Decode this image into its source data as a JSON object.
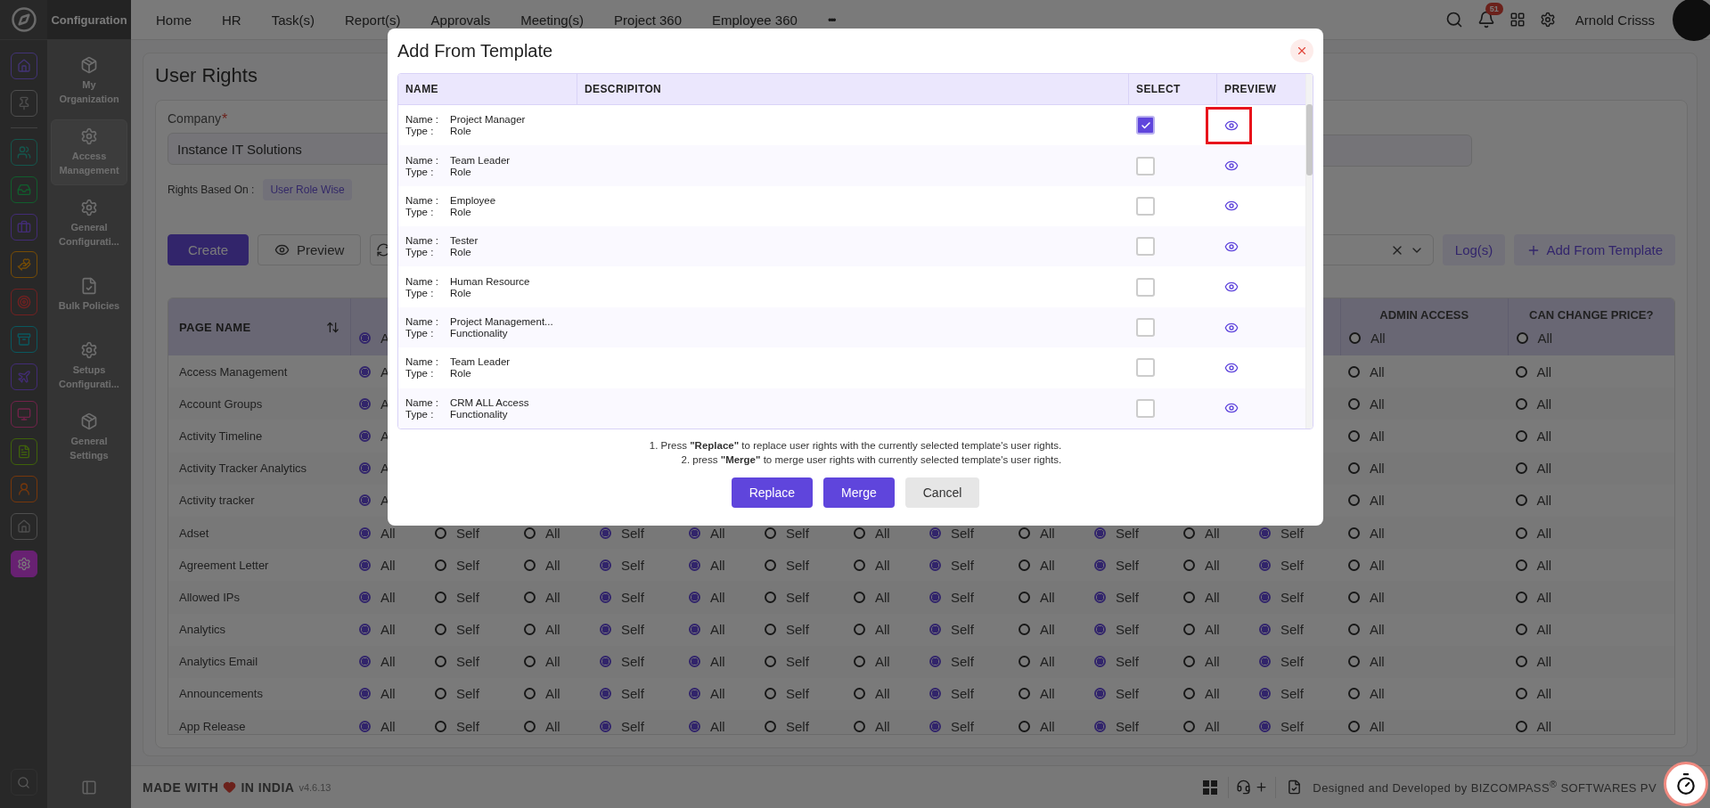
{
  "rail": {
    "items": [
      {
        "kind": "home",
        "selected": false
      },
      {
        "kind": "pin",
        "selected": false
      },
      {
        "kind": "people",
        "selected": false
      },
      {
        "kind": "inbox",
        "selected": false
      },
      {
        "kind": "briefcase",
        "selected": false
      },
      {
        "kind": "hands",
        "selected": false
      },
      {
        "kind": "target",
        "selected": false
      },
      {
        "kind": "archive",
        "selected": false
      },
      {
        "kind": "plane",
        "selected": false
      },
      {
        "kind": "monitor",
        "selected": false
      },
      {
        "kind": "file",
        "selected": false
      },
      {
        "kind": "person",
        "selected": false
      },
      {
        "kind": "house",
        "selected": false
      },
      {
        "kind": "gear",
        "selected": true
      }
    ]
  },
  "sidebar": {
    "title": "Configuration",
    "items": [
      {
        "kind": "cube",
        "label": "My Organization",
        "selected": false
      },
      {
        "kind": "gear",
        "label": "Access Management",
        "selected": true
      },
      {
        "kind": "gear",
        "label": "General Configurati...",
        "selected": false
      },
      {
        "kind": "file",
        "label": "Bulk Policies",
        "selected": false
      },
      {
        "kind": "gear",
        "label": "Setups Configurati...",
        "selected": false
      },
      {
        "kind": "cube",
        "label": "General Settings",
        "selected": false
      }
    ]
  },
  "topbar": {
    "nav": [
      "Home",
      "HR",
      "Task(s)",
      "Report(s)",
      "Approvals",
      "Meeting(s)",
      "Project 360",
      "Employee 360"
    ],
    "more": "•••",
    "notifications": "51",
    "user": "Arnold Crisss"
  },
  "page": {
    "title": "User Rights",
    "company": {
      "label": "Company",
      "required_mark": "*",
      "value": "Instance IT Solutions"
    },
    "rights_based_on": {
      "label": "Rights Based On :",
      "value": "User Role Wise"
    },
    "actions": [
      {
        "kind": "primary",
        "label": "Create"
      },
      {
        "kind": "preview",
        "label": "Preview"
      },
      {
        "kind": "icon"
      }
    ],
    "tools": {
      "logs": "Log(s)",
      "add_template": "Add From Template"
    }
  },
  "table": {
    "header": {
      "page_name": "PAGE NAME",
      "rights": [
        {
          "options": [
            {
              "label": "A",
              "selected": true
            }
          ]
        }
      ],
      "admin": {
        "label": "ADMIN ACCESS",
        "option": {
          "label": "All",
          "selected": false
        }
      },
      "price": {
        "label": "CAN CHANGE PRICE?",
        "option": {
          "label": "All",
          "selected": false
        }
      }
    },
    "rows": [
      {
        "page": "Access Management",
        "rights": [
          {
            "options": [
              {
                "label": "A",
                "selected": true
              }
            ]
          }
        ],
        "admin": {
          "label": "All",
          "selected": false
        },
        "price": {
          "label": "All",
          "selected": false
        }
      },
      {
        "page": "Account Groups",
        "rights": [
          {
            "options": [
              {
                "label": "A",
                "selected": true
              }
            ]
          }
        ],
        "admin": {
          "label": "All",
          "selected": false
        },
        "price": {
          "label": "All",
          "selected": false
        }
      },
      {
        "page": "Activity Timeline",
        "rights": [
          {
            "options": [
              {
                "label": "A",
                "selected": true
              }
            ]
          }
        ],
        "admin": {
          "label": "All",
          "selected": false
        },
        "price": {
          "label": "All",
          "selected": false
        }
      },
      {
        "page": "Activity Tracker Analytics",
        "rights": [
          {
            "options": [
              {
                "label": "A",
                "selected": true
              }
            ]
          }
        ],
        "admin": {
          "label": "All",
          "selected": false
        },
        "price": {
          "label": "All",
          "selected": false
        }
      },
      {
        "page": "Activity tracker",
        "rights": [
          {
            "options": [
              {
                "label": "A",
                "selected": true
              }
            ]
          }
        ],
        "admin": {
          "label": "All",
          "selected": false
        },
        "price": {
          "label": "All",
          "selected": false
        }
      },
      {
        "page": "Adset",
        "rights": [
          {
            "options": [
              {
                "label": "All",
                "selected": true
              },
              {
                "label": "Self",
                "selected": false
              }
            ]
          },
          {
            "options": [
              {
                "label": "All",
                "selected": false
              },
              {
                "label": "Self",
                "selected": true
              }
            ]
          },
          {
            "options": [
              {
                "label": "All",
                "selected": true
              },
              {
                "label": "Self",
                "selected": false
              }
            ]
          },
          {
            "options": [
              {
                "label": "All",
                "selected": false
              },
              {
                "label": "Self",
                "selected": true
              }
            ]
          },
          {
            "options": [
              {
                "label": "All",
                "selected": false
              },
              {
                "label": "Self",
                "selected": true
              }
            ]
          },
          {
            "options": [
              {
                "label": "All",
                "selected": false
              },
              {
                "label": "Self",
                "selected": true
              }
            ]
          }
        ],
        "admin": {
          "label": "All",
          "selected": false
        },
        "price": {
          "label": "All",
          "selected": false
        }
      },
      {
        "page": "Agreement Letter",
        "rights": [
          {
            "options": [
              {
                "label": "All",
                "selected": true
              },
              {
                "label": "Self",
                "selected": false
              }
            ]
          },
          {
            "options": [
              {
                "label": "All",
                "selected": false
              },
              {
                "label": "Self",
                "selected": true
              }
            ]
          },
          {
            "options": [
              {
                "label": "All",
                "selected": true
              },
              {
                "label": "Self",
                "selected": false
              }
            ]
          },
          {
            "options": [
              {
                "label": "All",
                "selected": false
              },
              {
                "label": "Self",
                "selected": true
              }
            ]
          },
          {
            "options": [
              {
                "label": "All",
                "selected": false
              },
              {
                "label": "Self",
                "selected": true
              }
            ]
          },
          {
            "options": [
              {
                "label": "All",
                "selected": false
              },
              {
                "label": "Self",
                "selected": true
              }
            ]
          }
        ],
        "admin": {
          "label": "All",
          "selected": false
        },
        "price": {
          "label": "All",
          "selected": false
        }
      },
      {
        "page": "Allowed IPs",
        "rights": [
          {
            "options": [
              {
                "label": "All",
                "selected": true
              },
              {
                "label": "Self",
                "selected": false
              }
            ]
          },
          {
            "options": [
              {
                "label": "All",
                "selected": false
              },
              {
                "label": "Self",
                "selected": true
              }
            ]
          },
          {
            "options": [
              {
                "label": "All",
                "selected": true
              },
              {
                "label": "Self",
                "selected": false
              }
            ]
          },
          {
            "options": [
              {
                "label": "All",
                "selected": false
              },
              {
                "label": "Self",
                "selected": true
              }
            ]
          },
          {
            "options": [
              {
                "label": "All",
                "selected": false
              },
              {
                "label": "Self",
                "selected": true
              }
            ]
          },
          {
            "options": [
              {
                "label": "All",
                "selected": false
              },
              {
                "label": "Self",
                "selected": true
              }
            ]
          }
        ],
        "admin": {
          "label": "All",
          "selected": false
        },
        "price": {
          "label": "All",
          "selected": false
        }
      },
      {
        "page": "Analytics",
        "rights": [
          {
            "options": [
              {
                "label": "All",
                "selected": true
              },
              {
                "label": "Self",
                "selected": false
              }
            ]
          },
          {
            "options": [
              {
                "label": "All",
                "selected": false
              },
              {
                "label": "Self",
                "selected": true
              }
            ]
          },
          {
            "options": [
              {
                "label": "All",
                "selected": true
              },
              {
                "label": "Self",
                "selected": false
              }
            ]
          },
          {
            "options": [
              {
                "label": "All",
                "selected": false
              },
              {
                "label": "Self",
                "selected": true
              }
            ]
          },
          {
            "options": [
              {
                "label": "All",
                "selected": false
              },
              {
                "label": "Self",
                "selected": true
              }
            ]
          },
          {
            "options": [
              {
                "label": "All",
                "selected": false
              },
              {
                "label": "Self",
                "selected": true
              }
            ]
          }
        ],
        "admin": {
          "label": "All",
          "selected": false
        },
        "price": {
          "label": "All",
          "selected": false
        }
      },
      {
        "page": "Analytics Email",
        "rights": [
          {
            "options": [
              {
                "label": "All",
                "selected": true
              },
              {
                "label": "Self",
                "selected": false
              }
            ]
          },
          {
            "options": [
              {
                "label": "All",
                "selected": false
              },
              {
                "label": "Self",
                "selected": true
              }
            ]
          },
          {
            "options": [
              {
                "label": "All",
                "selected": true
              },
              {
                "label": "Self",
                "selected": false
              }
            ]
          },
          {
            "options": [
              {
                "label": "All",
                "selected": false
              },
              {
                "label": "Self",
                "selected": true
              }
            ]
          },
          {
            "options": [
              {
                "label": "All",
                "selected": false
              },
              {
                "label": "Self",
                "selected": true
              }
            ]
          },
          {
            "options": [
              {
                "label": "All",
                "selected": false
              },
              {
                "label": "Self",
                "selected": true
              }
            ]
          }
        ],
        "admin": {
          "label": "All",
          "selected": false
        },
        "price": {
          "label": "All",
          "selected": false
        }
      },
      {
        "page": "Announcements",
        "rights": [
          {
            "options": [
              {
                "label": "All",
                "selected": true
              },
              {
                "label": "Self",
                "selected": false
              }
            ]
          },
          {
            "options": [
              {
                "label": "All",
                "selected": false
              },
              {
                "label": "Self",
                "selected": true
              }
            ]
          },
          {
            "options": [
              {
                "label": "All",
                "selected": true
              },
              {
                "label": "Self",
                "selected": false
              }
            ]
          },
          {
            "options": [
              {
                "label": "All",
                "selected": false
              },
              {
                "label": "Self",
                "selected": true
              }
            ]
          },
          {
            "options": [
              {
                "label": "All",
                "selected": false
              },
              {
                "label": "Self",
                "selected": true
              }
            ]
          },
          {
            "options": [
              {
                "label": "All",
                "selected": false
              },
              {
                "label": "Self",
                "selected": true
              }
            ]
          }
        ],
        "admin": {
          "label": "All",
          "selected": false
        },
        "price": {
          "label": "All",
          "selected": false
        }
      },
      {
        "page": "App Release",
        "rights": [
          {
            "options": [
              {
                "label": "All",
                "selected": true
              },
              {
                "label": "Self",
                "selected": false
              }
            ]
          },
          {
            "options": [
              {
                "label": "All",
                "selected": false
              },
              {
                "label": "Self",
                "selected": true
              }
            ]
          },
          {
            "options": [
              {
                "label": "All",
                "selected": true
              },
              {
                "label": "Self",
                "selected": false
              }
            ]
          },
          {
            "options": [
              {
                "label": "All",
                "selected": false
              },
              {
                "label": "Self",
                "selected": true
              }
            ]
          },
          {
            "options": [
              {
                "label": "All",
                "selected": false
              },
              {
                "label": "Self",
                "selected": true
              }
            ]
          },
          {
            "options": [
              {
                "label": "All",
                "selected": false
              },
              {
                "label": "Self",
                "selected": true
              }
            ]
          }
        ],
        "admin": {
          "label": "All",
          "selected": false
        },
        "price": {
          "label": "All",
          "selected": false
        }
      }
    ]
  },
  "footer": {
    "made_with": "MADE WITH",
    "in_india": "IN INDIA",
    "version": "v4.6.13",
    "credit": "Designed and Developed by  BIZCOMPASS$^{®}$ SOFTWARES PV"
  },
  "modal": {
    "title": "Add From Template",
    "columns": [
      "NAME",
      "DESCRIPITON",
      "SELECT",
      "PREVIEW"
    ],
    "rows": [
      {
        "name_label": "Name :",
        "name": "Project Manager",
        "type_label": "Type :",
        "type": "Role",
        "selected": true,
        "highlighted": true
      },
      {
        "name_label": "Name :",
        "name": "Team Leader",
        "type_label": "Type :",
        "type": "Role",
        "selected": false,
        "highlighted": false
      },
      {
        "name_label": "Name :",
        "name": "Employee",
        "type_label": "Type :",
        "type": "Role",
        "selected": false,
        "highlighted": false
      },
      {
        "name_label": "Name :",
        "name": "Tester",
        "type_label": "Type :",
        "type": "Role",
        "selected": false,
        "highlighted": false
      },
      {
        "name_label": "Name :",
        "name": "Human Resource",
        "type_label": "Type :",
        "type": "Role",
        "selected": false,
        "highlighted": false
      },
      {
        "name_label": "Name :",
        "name": "Project Management...",
        "type_label": "Type :",
        "type": "Functionality",
        "selected": false,
        "highlighted": false
      },
      {
        "name_label": "Name :",
        "name": "Team Leader",
        "type_label": "Type :",
        "type": "Role",
        "selected": false,
        "highlighted": false
      },
      {
        "name_label": "Name :",
        "name": "CRM ALL Access",
        "type_label": "Type :",
        "type": "Functionality",
        "selected": false,
        "highlighted": false
      }
    ],
    "notes": [
      "1. Press **\"Replace\"** to replace user rights with the currently selected template's user rights.",
      "2. press **\"Merge\"** to merge user rights with currently selected template's user rights."
    ],
    "buttons": [
      {
        "kind": "primary",
        "label": "Replace"
      },
      {
        "kind": "primary",
        "label": "Merge"
      },
      {
        "kind": "secondary",
        "label": "Cancel"
      }
    ]
  }
}
